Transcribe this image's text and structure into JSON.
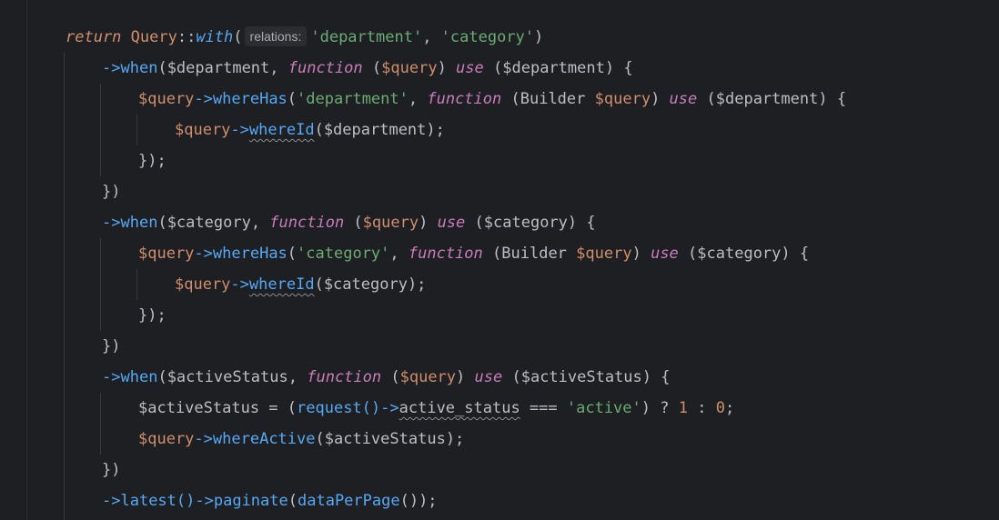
{
  "editor": {
    "background": "#1e1f22",
    "lines": [
      {
        "tokens": [
          "return",
          " ",
          "Query",
          "::",
          "with",
          "(",
          "relations:",
          "'department'",
          ", ",
          "'category'",
          ")"
        ]
      },
      {
        "tokens": [
          "->",
          "when",
          "(",
          "$department",
          ", ",
          "function",
          " (",
          "$query",
          ") ",
          "use",
          " (",
          "$department",
          ") {"
        ]
      },
      {
        "tokens": [
          "$query",
          "->",
          "whereHas",
          "(",
          "'department'",
          ", ",
          "function",
          " (",
          "Builder",
          " ",
          "$query",
          ") ",
          "use",
          " (",
          "$department",
          ") {"
        ]
      },
      {
        "tokens": [
          "$query",
          "->",
          "whereId",
          "(",
          "$department",
          ");"
        ]
      },
      {
        "tokens": [
          "});"
        ]
      },
      {
        "tokens": [
          "})"
        ]
      },
      {
        "tokens": [
          "->",
          "when",
          "(",
          "$category",
          ", ",
          "function",
          " (",
          "$query",
          ") ",
          "use",
          " (",
          "$category",
          ") {"
        ]
      },
      {
        "tokens": [
          "$query",
          "->",
          "whereHas",
          "(",
          "'category'",
          ", ",
          "function",
          " (",
          "Builder",
          " ",
          "$query",
          ") ",
          "use",
          " (",
          "$category",
          ") {"
        ]
      },
      {
        "tokens": [
          "$query",
          "->",
          "whereId",
          "(",
          "$category",
          ");"
        ]
      },
      {
        "tokens": [
          "});"
        ]
      },
      {
        "tokens": [
          "})"
        ]
      },
      {
        "tokens": [
          "->",
          "when",
          "(",
          "$activeStatus",
          ", ",
          "function",
          " (",
          "$query",
          ") ",
          "use",
          " (",
          "$activeStatus",
          ") {"
        ]
      },
      {
        "tokens": [
          "$activeStatus",
          " = (",
          "request",
          "()->",
          "active_status",
          " === ",
          "'active'",
          ") ? ",
          "1",
          " : ",
          "0",
          ";"
        ]
      },
      {
        "tokens": [
          "$query",
          "->",
          "whereActive",
          "(",
          "$activeStatus",
          ");"
        ]
      },
      {
        "tokens": [
          "})"
        ]
      },
      {
        "tokens": [
          "->",
          "latest",
          "()->",
          "paginate",
          "(",
          "dataPerPage",
          "());"
        ]
      }
    ]
  }
}
